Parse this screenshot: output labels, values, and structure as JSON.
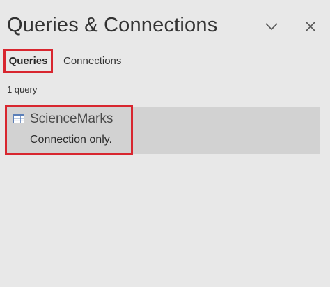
{
  "pane": {
    "title": "Queries & Connections",
    "collapse_icon": "chevron-down-icon",
    "close_icon": "close-icon"
  },
  "tabs": [
    {
      "label": "Queries",
      "selected": true
    },
    {
      "label": "Connections",
      "selected": false
    }
  ],
  "queries": {
    "count_label": "1 query",
    "items": [
      {
        "name": "ScienceMarks",
        "status": "Connection only.",
        "icon": "table-icon"
      }
    ]
  },
  "colors": {
    "highlight": "#d8262f",
    "background": "#e8e8e8",
    "selected_item": "#d2d2d2",
    "table_icon": "#5b7fb8"
  }
}
